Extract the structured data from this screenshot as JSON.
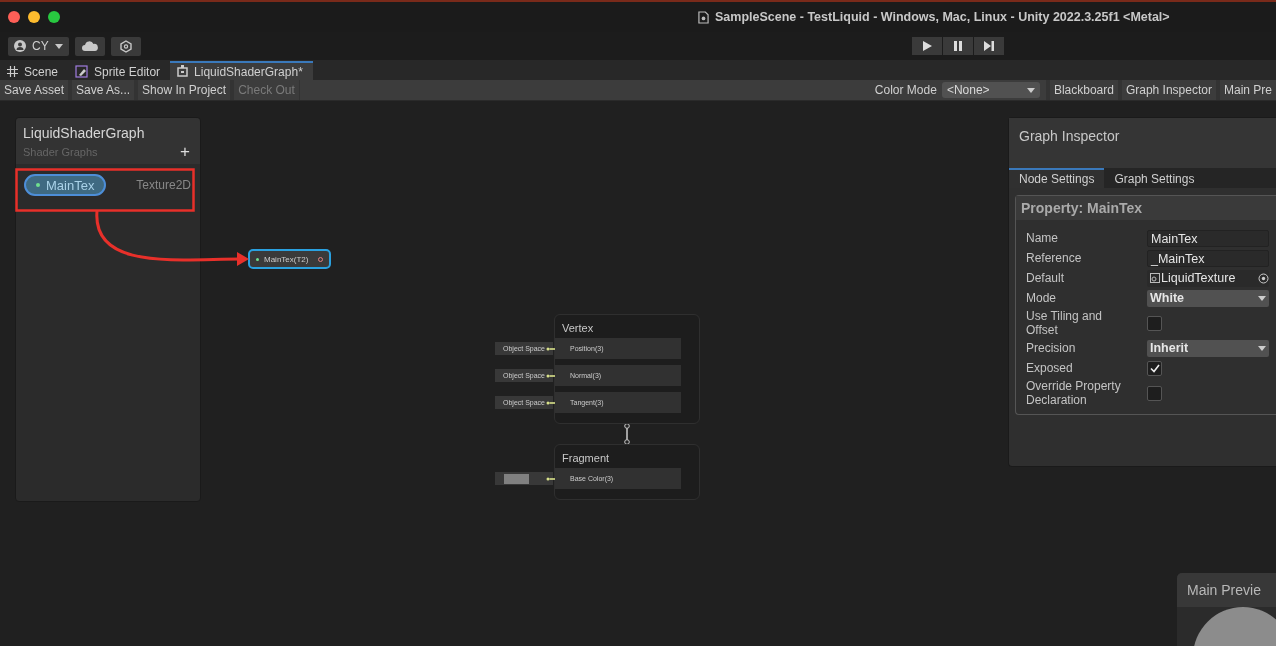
{
  "window": {
    "title": "SampleScene - TestLiquid - Windows, Mac, Linux - Unity 2022.3.25f1 <Metal>"
  },
  "account": {
    "label": "CY"
  },
  "tabs": [
    {
      "label": "Scene",
      "kind": "grid",
      "selected": false
    },
    {
      "label": "Sprite Editor",
      "kind": "sprite",
      "selected": false
    },
    {
      "label": "LiquidShaderGraph*",
      "kind": "graph",
      "selected": true
    }
  ],
  "graph_toolbar": {
    "buttons": [
      {
        "label": "Save Asset",
        "disabled": false
      },
      {
        "label": "Save As...",
        "disabled": false
      },
      {
        "label": "Show In Project",
        "disabled": false
      },
      {
        "label": "Check Out",
        "disabled": true
      }
    ],
    "color_mode_label": "Color Mode",
    "color_mode_value": "<None>",
    "panel_buttons": [
      "Blackboard",
      "Graph Inspector",
      "Main Pre"
    ]
  },
  "blackboard": {
    "title": "LiquidShaderGraph",
    "subtitle": "Shader Graphs",
    "add": "+",
    "properties": [
      {
        "name": "MainTex",
        "type": "Texture2D",
        "selected": true
      }
    ]
  },
  "property_node": {
    "label": "MainTex(T2)",
    "selected": true
  },
  "master_stack": [
    {
      "title": "Vertex",
      "ports": [
        {
          "label": "Position(3)",
          "kind": "space",
          "input": "Object Space"
        },
        {
          "label": "Normal(3)",
          "kind": "space",
          "input": "Object Space"
        },
        {
          "label": "Tangent(3)",
          "kind": "space",
          "input": "Object Space"
        }
      ]
    },
    {
      "title": "Fragment",
      "ports": [
        {
          "label": "Base Color(3)",
          "kind": "color",
          "color": "#808080"
        }
      ]
    }
  ],
  "graph_inspector": {
    "title": "Graph Inspector",
    "tabs": [
      {
        "label": "Node Settings",
        "selected": true
      },
      {
        "label": "Graph Settings",
        "selected": false
      }
    ],
    "section_title": "Property: MainTex",
    "fields": [
      {
        "label": "Name",
        "kind": "text",
        "value": "MainTex"
      },
      {
        "label": "Reference",
        "kind": "text",
        "value": "_MainTex"
      },
      {
        "label": "Default",
        "kind": "object",
        "value": "LiquidTexture"
      },
      {
        "label": "Mode",
        "kind": "dropdown",
        "value": "White"
      },
      {
        "label": "Use Tiling and Offset",
        "kind": "toggle",
        "checked": false
      },
      {
        "label": "Precision",
        "kind": "dropdown",
        "value": "Inherit"
      },
      {
        "label": "Exposed",
        "kind": "toggle",
        "checked": true
      },
      {
        "label": "Override Property Declaration",
        "kind": "toggle",
        "checked": false
      }
    ]
  },
  "main_preview": {
    "title": "Main Previe"
  }
}
